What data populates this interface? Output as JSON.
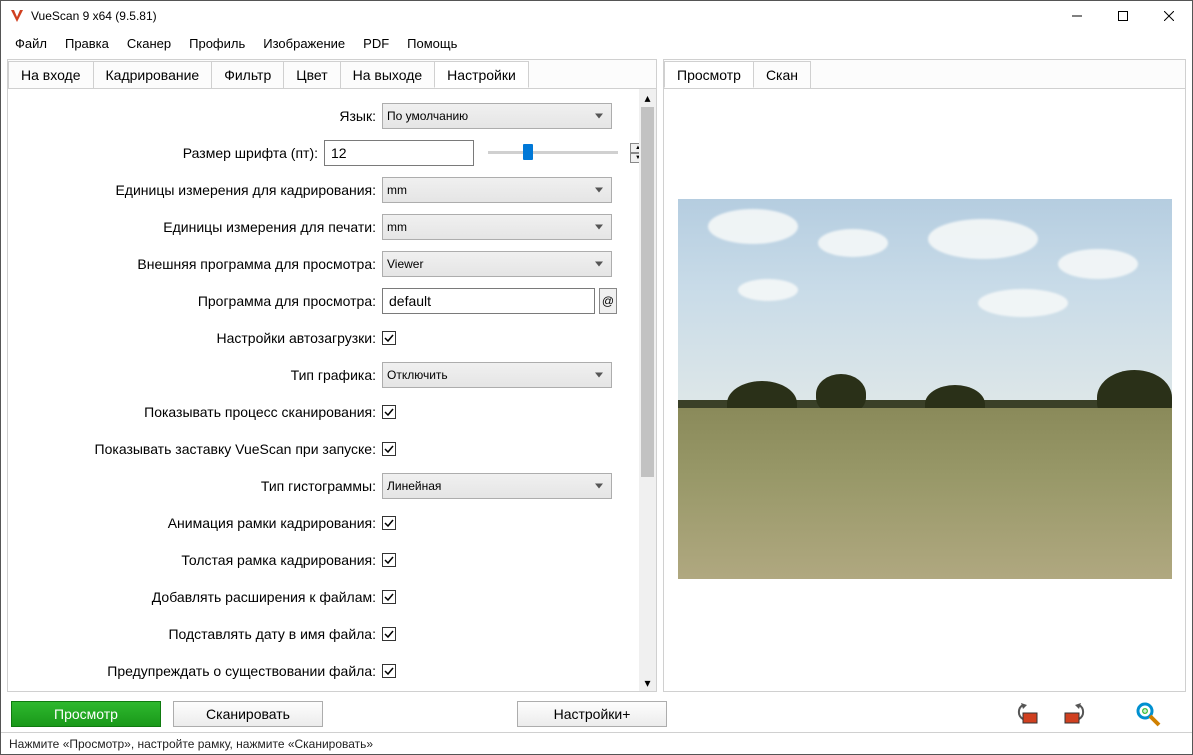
{
  "window": {
    "title": "VueScan 9 x64 (9.5.81)"
  },
  "menu": [
    "Файл",
    "Правка",
    "Сканер",
    "Профиль",
    "Изображение",
    "PDF",
    "Помощь"
  ],
  "left_tabs": [
    "На входе",
    "Кадрирование",
    "Фильтр",
    "Цвет",
    "На выходе",
    "Настройки"
  ],
  "left_active_tab": 5,
  "right_tabs": [
    "Просмотр",
    "Скан"
  ],
  "right_active_tab": 0,
  "settings": {
    "language": {
      "label": "Язык:",
      "value": "По умолчанию"
    },
    "font_size": {
      "label": "Размер шрифта (пт):",
      "value": "12"
    },
    "crop_units": {
      "label": "Единицы измерения для кадрирования:",
      "value": "mm"
    },
    "print_units": {
      "label": "Единицы измерения для печати:",
      "value": "mm"
    },
    "ext_viewer": {
      "label": "Внешняя программа для просмотра:",
      "value": "Viewer"
    },
    "viewer_prog": {
      "label": "Программа для просмотра:",
      "value": "default"
    },
    "autoload": {
      "label": "Настройки автозагрузки:",
      "checked": true
    },
    "graph_type": {
      "label": "Тип графика:",
      "value": "Отключить"
    },
    "show_scan_progress": {
      "label": "Показывать процесс сканирования:",
      "checked": true
    },
    "show_splash": {
      "label": "Показывать заставку VueScan при запуске:",
      "checked": true
    },
    "histogram_type": {
      "label": "Тип гистограммы:",
      "value": "Линейная"
    },
    "crop_anim": {
      "label": "Анимация рамки кадрирования:",
      "checked": true
    },
    "thick_crop": {
      "label": "Толстая рамка кадрирования:",
      "checked": true
    },
    "add_ext": {
      "label": "Добавлять расширения к файлам:",
      "checked": true
    },
    "subst_date": {
      "label": "Подставлять дату в имя файла:",
      "checked": true
    },
    "warn_exist": {
      "label": "Предупреждать о существовании файла:",
      "checked": true
    }
  },
  "buttons": {
    "preview": "Просмотр",
    "scan": "Сканировать",
    "settings_plus": "Настройки+"
  },
  "status": "Нажмите «Просмотр», настройте рамку, нажмите «Сканировать»"
}
